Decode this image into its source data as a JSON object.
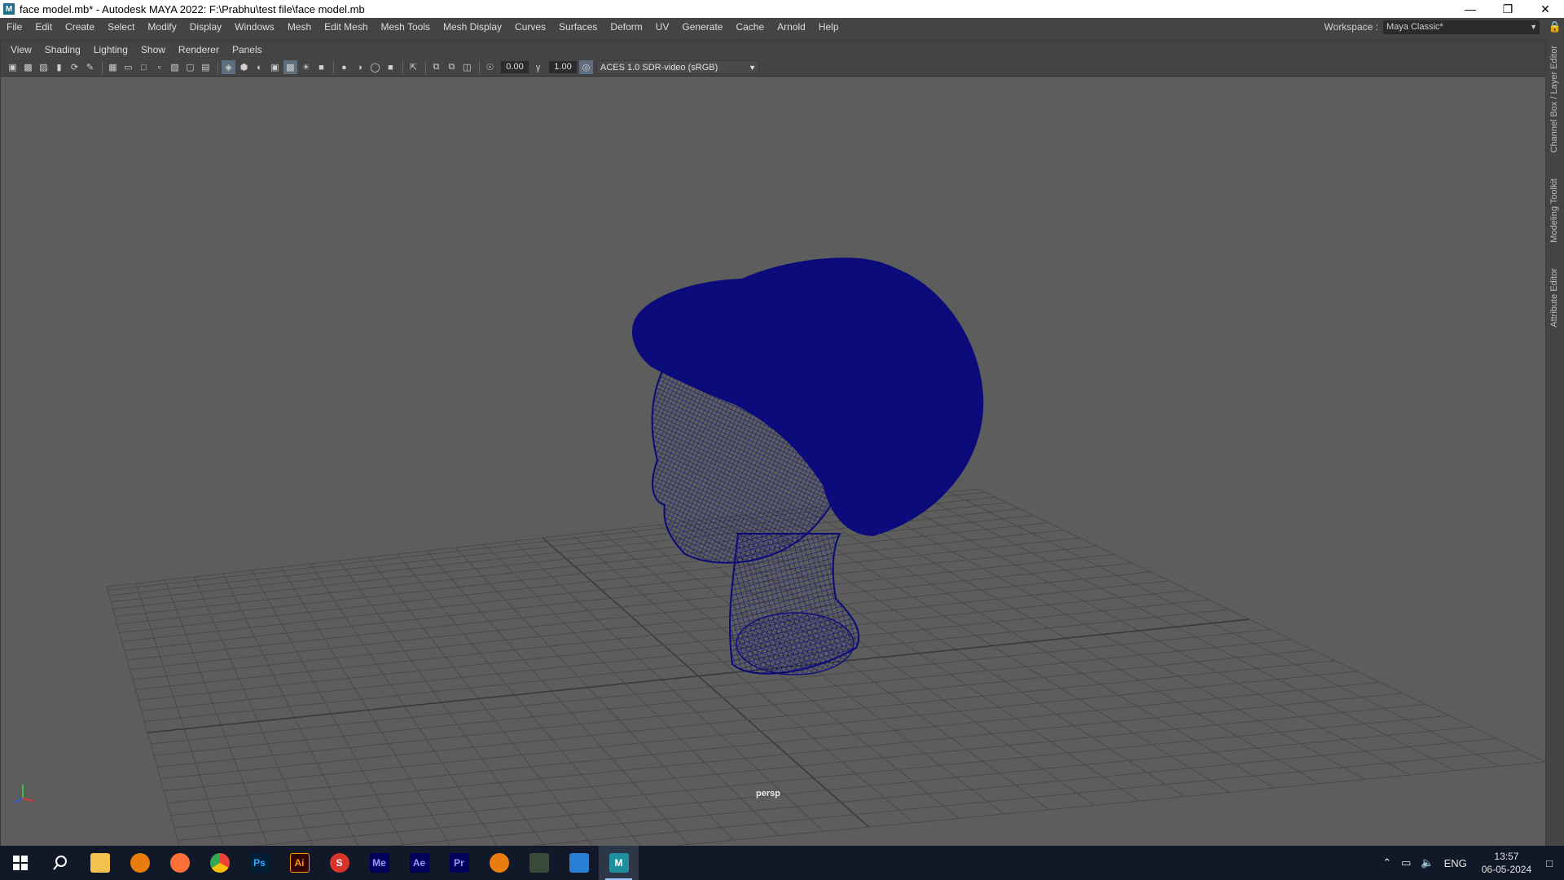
{
  "window": {
    "title": "face model.mb* - Autodesk MAYA 2022: F:\\Prabhu\\test file\\face model.mb",
    "app_icon": "M"
  },
  "menubar": {
    "items": [
      "File",
      "Edit",
      "Create",
      "Select",
      "Modify",
      "Display",
      "Windows",
      "Mesh",
      "Edit Mesh",
      "Mesh Tools",
      "Mesh Display",
      "Curves",
      "Surfaces",
      "Deform",
      "UV",
      "Generate",
      "Cache",
      "Arnold",
      "Help"
    ],
    "workspace_label": "Workspace :",
    "workspace_value": "Maya Classic*"
  },
  "panel_menu": {
    "items": [
      "View",
      "Shading",
      "Lighting",
      "Show",
      "Renderer",
      "Panels"
    ]
  },
  "toolbar": {
    "exposure": "0.00",
    "gamma": "1.00",
    "color_space": "ACES 1.0 SDR-video (sRGB)"
  },
  "viewport": {
    "camera_label": "persp",
    "wireframe_color": "#0a0a7a",
    "background_color": "#5d5d5d",
    "grid_color": "#4a4a4a"
  },
  "right_tabs": [
    "Channel Box / Layer Editor",
    "Modeling Toolkit",
    "Attribute Editor"
  ],
  "taskbar": {
    "apps": [
      {
        "name": "start",
        "label": ""
      },
      {
        "name": "search",
        "label": ""
      },
      {
        "name": "file-explorer",
        "label": ""
      },
      {
        "name": "blender",
        "label": ""
      },
      {
        "name": "firefox",
        "label": ""
      },
      {
        "name": "chrome",
        "label": ""
      },
      {
        "name": "photoshop",
        "label": "Ps"
      },
      {
        "name": "illustrator",
        "label": "Ai"
      },
      {
        "name": "sketchup",
        "label": "S"
      },
      {
        "name": "media-encoder",
        "label": "Me"
      },
      {
        "name": "after-effects",
        "label": "Ae"
      },
      {
        "name": "premiere",
        "label": "Pr"
      },
      {
        "name": "blender-2",
        "label": ""
      },
      {
        "name": "vectornator",
        "label": ""
      },
      {
        "name": "photos",
        "label": ""
      },
      {
        "name": "maya",
        "label": "M"
      }
    ],
    "language": "ENG",
    "time": "13:57",
    "date": "06-05-2024"
  }
}
